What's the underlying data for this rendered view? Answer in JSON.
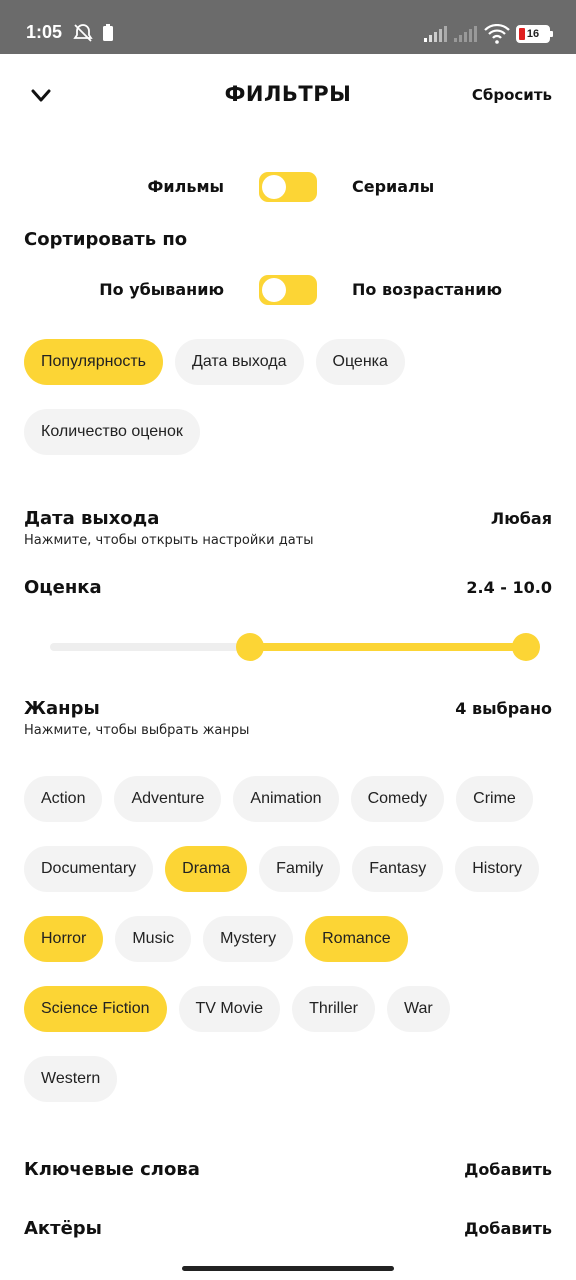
{
  "status_bar": {
    "time": "1:05",
    "battery": "16",
    "icons": [
      "alarm-off-icon",
      "battery-saver-icon",
      "signal-icon",
      "signal-icon",
      "wifi-icon",
      "battery-icon"
    ]
  },
  "header": {
    "title": "ФИЛЬТРЫ",
    "reset_label": "Сбросить",
    "back_icon": "chevron-down-icon"
  },
  "type_toggle": {
    "left_label": "Фильмы",
    "right_label": "Сериалы"
  },
  "sort": {
    "title": "Сортировать по",
    "order_left": "По убыванию",
    "order_right": "По возрастанию",
    "options": [
      {
        "label": "Популярность",
        "selected": true
      },
      {
        "label": "Дата выхода",
        "selected": false
      },
      {
        "label": "Оценка",
        "selected": false
      },
      {
        "label": "Количество оценок",
        "selected": false
      }
    ]
  },
  "release_date": {
    "title": "Дата выхода",
    "subtitle": "Нажмите, чтобы открыть настройки даты",
    "value": "Любая"
  },
  "rating": {
    "title": "Оценка",
    "value": "2.4 - 10.0",
    "min": 0,
    "max": 10,
    "low": 2.4,
    "high": 10.0
  },
  "genres": {
    "title": "Жанры",
    "subtitle": "Нажмите, чтобы выбрать жанры",
    "value": "4 выбрано",
    "items": [
      {
        "label": "Action",
        "selected": false
      },
      {
        "label": "Adventure",
        "selected": false
      },
      {
        "label": "Animation",
        "selected": false
      },
      {
        "label": "Comedy",
        "selected": false
      },
      {
        "label": "Crime",
        "selected": false
      },
      {
        "label": "Documentary",
        "selected": false
      },
      {
        "label": "Drama",
        "selected": true
      },
      {
        "label": "Family",
        "selected": false
      },
      {
        "label": "Fantasy",
        "selected": false
      },
      {
        "label": "History",
        "selected": false
      },
      {
        "label": "Horror",
        "selected": true
      },
      {
        "label": "Music",
        "selected": false
      },
      {
        "label": "Mystery",
        "selected": false
      },
      {
        "label": "Romance",
        "selected": true
      },
      {
        "label": "Science Fiction",
        "selected": true
      },
      {
        "label": "TV Movie",
        "selected": false
      },
      {
        "label": "Thriller",
        "selected": false
      },
      {
        "label": "War",
        "selected": false
      },
      {
        "label": "Western",
        "selected": false
      }
    ]
  },
  "keywords": {
    "title": "Ключевые слова",
    "action": "Добавить"
  },
  "actors": {
    "title": "Актёры",
    "action": "Добавить"
  },
  "colors": {
    "accent": "#fcd535",
    "chip_bg": "#f3f3f3",
    "status_bar": "#6b6b6b"
  }
}
